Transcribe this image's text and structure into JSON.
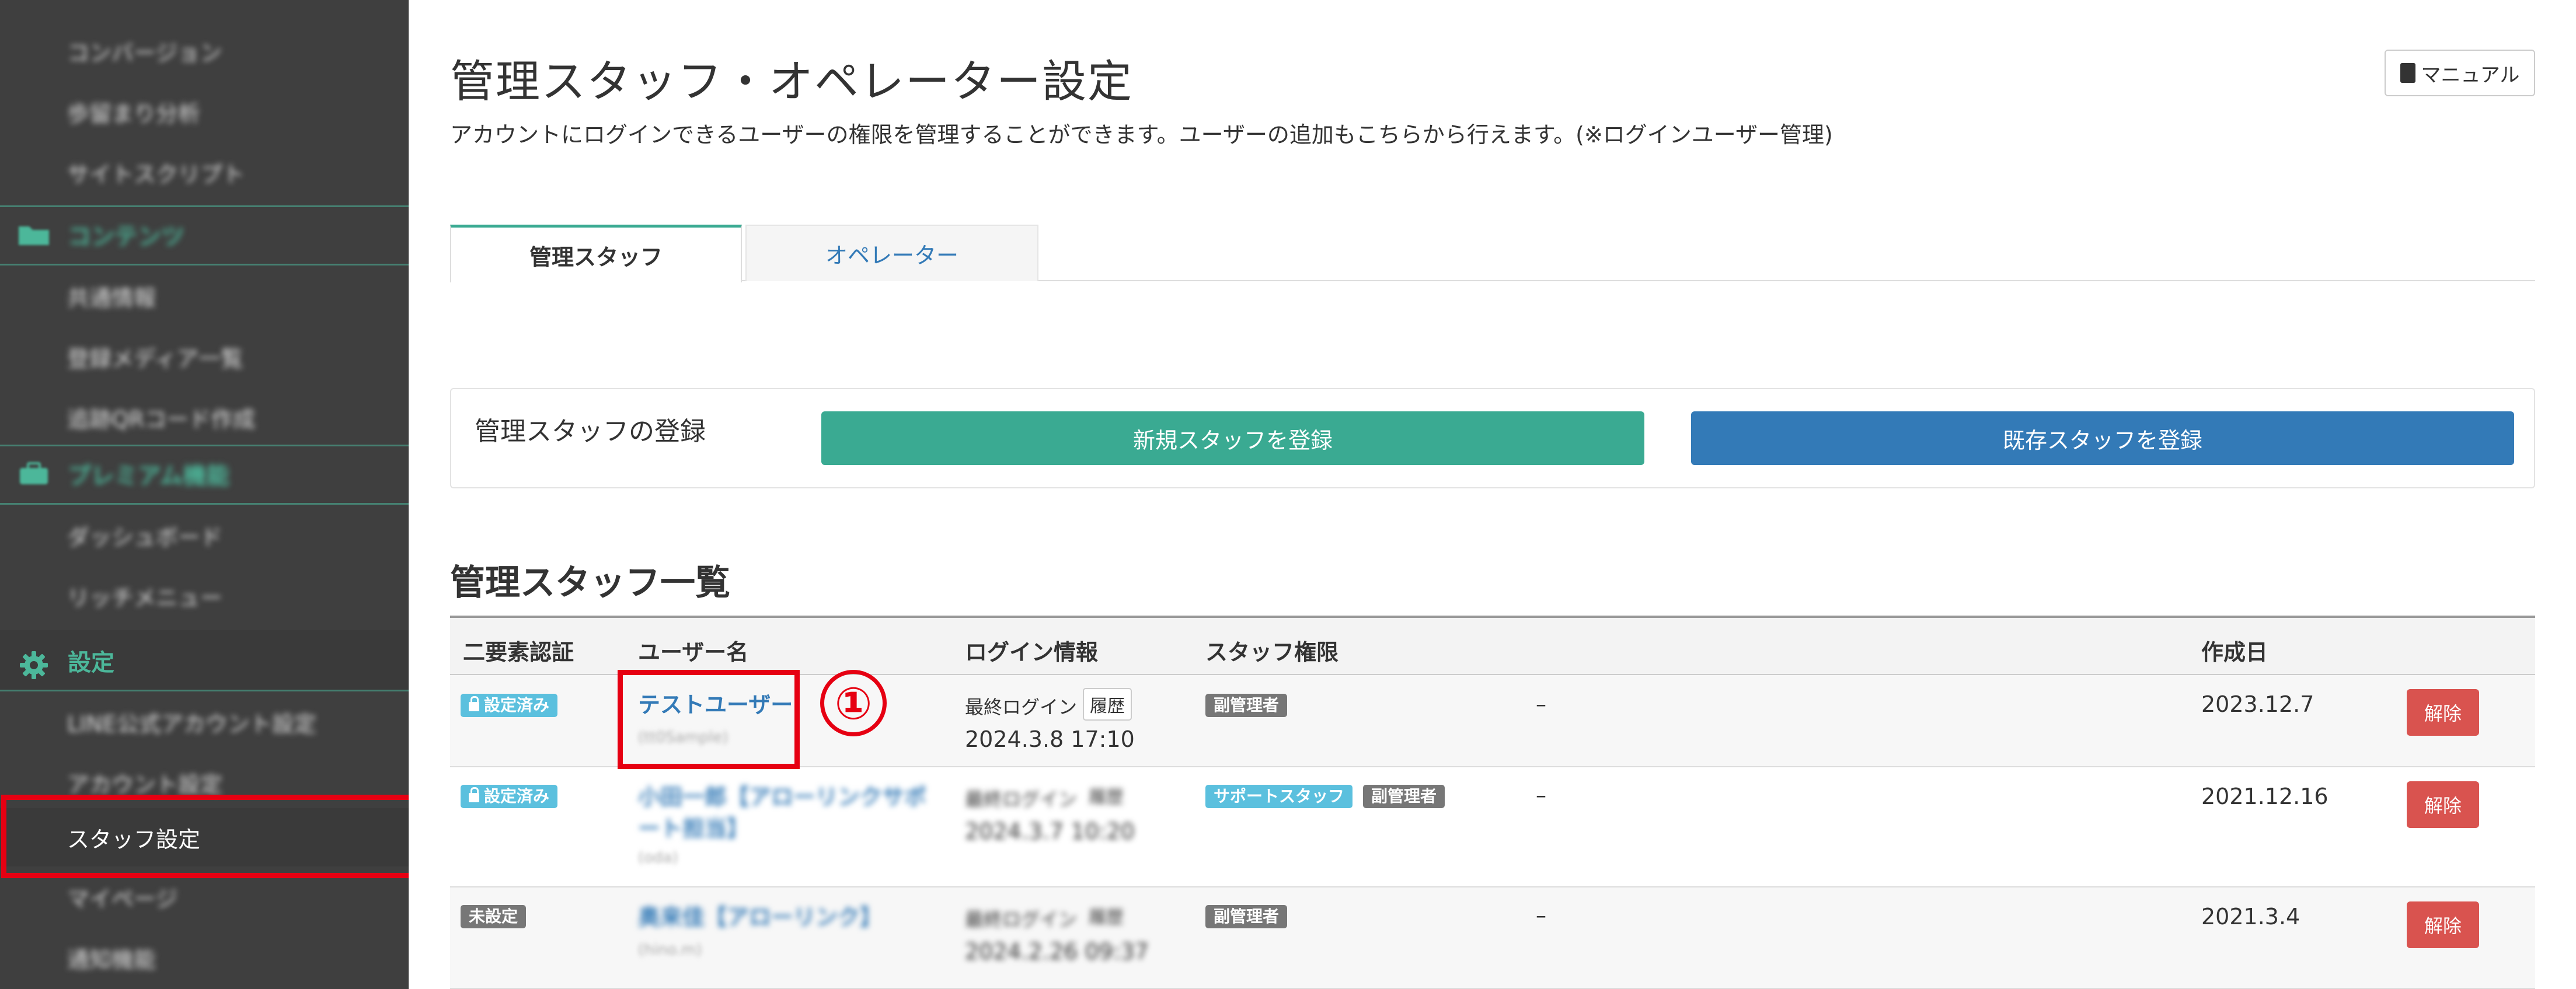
{
  "sidebar": {
    "items": [
      {
        "label": "コンバージョン"
      },
      {
        "label": "歩留まり分析"
      },
      {
        "label": "サイトスクリプト"
      },
      {
        "label": "コンテンツ"
      },
      {
        "label": "共通情報"
      },
      {
        "label": "登録メディア一覧"
      },
      {
        "label": "追跡QRコード作成"
      },
      {
        "label": "プレミアム機能"
      },
      {
        "label": "ダッシュボード"
      },
      {
        "label": "リッチメニュー"
      },
      {
        "label": "設定"
      },
      {
        "label": "LINE公式アカウント設定"
      },
      {
        "label": "アカウント設定"
      },
      {
        "label": "スタッフ設定"
      },
      {
        "label": "マイページ"
      },
      {
        "label": "通知機能"
      }
    ]
  },
  "header": {
    "title": "管理スタッフ・オペレーター設定",
    "subtitle": "アカウントにログインできるユーザーの権限を管理することができます。ユーザーの追加もこちらから行えます。(※ログインユーザー管理)",
    "manual_label": "マニュアル"
  },
  "tabs": [
    {
      "label": "管理スタッフ"
    },
    {
      "label": "オペレーター"
    }
  ],
  "register": {
    "label": "管理スタッフの登録",
    "new_button": "新規スタッフを登録",
    "existing_button": "既存スタッフを登録"
  },
  "list": {
    "title": "管理スタッフ一覧",
    "columns": [
      "二要素認証",
      "ユーザー名",
      "ログイン情報",
      "スタッフ権限",
      "作成日"
    ],
    "rows": [
      {
        "twofa": "設定済み",
        "username": "テストユーザー",
        "userid": "(tt0Sample)",
        "login_label": "最終ログイン",
        "history": "履歴",
        "login_time": "2024.3.8 17:10",
        "roles": [
          "副管理者"
        ],
        "note": "–",
        "created": "2023.12.7",
        "action": "解除"
      },
      {
        "twofa": "設定済み",
        "username_line1": "小田一郎【アローリンクサポ",
        "username_line2": "ート担当】",
        "userid": "(oda)",
        "login_label": "最終ログイン",
        "history": "履歴",
        "login_time": "2024.3.7 10:20",
        "roles": [
          "サポートスタッフ",
          "副管理者"
        ],
        "note": "–",
        "created": "2021.12.16",
        "action": "解除"
      },
      {
        "twofa": "未設定",
        "username": "奥来佳【アローリンク】",
        "userid": "(hino.m)",
        "login_label": "最終ログイン",
        "history": "履歴",
        "login_time": "2024.2.26 09:37",
        "roles": [
          "副管理者"
        ],
        "note": "–",
        "created": "2021.3.4",
        "action": "解除"
      }
    ]
  },
  "annotation": {
    "step_number": "①"
  },
  "colors": {
    "sidebar_bg": "#3f3f3f",
    "accent_green": "#3aaa92",
    "primary_blue": "#337ab7",
    "danger_red": "#d9534f",
    "highlight_red": "#e60012"
  }
}
